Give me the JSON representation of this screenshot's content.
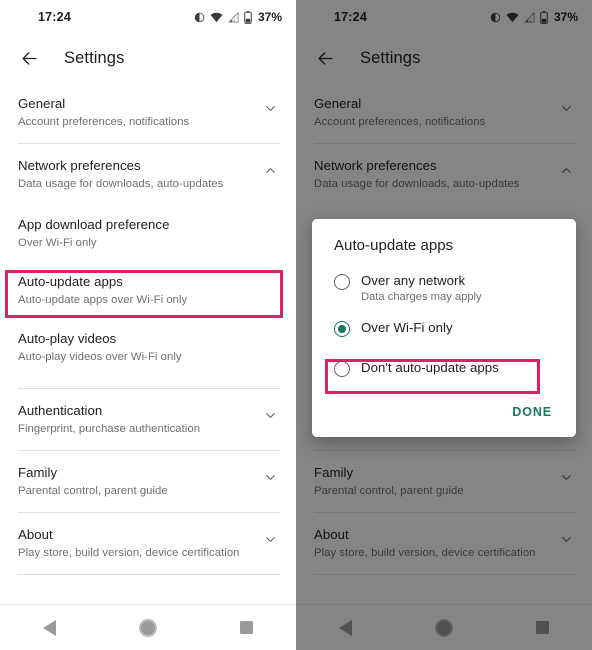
{
  "status_bar": {
    "time": "17:24",
    "battery_percent": "37%",
    "icons": [
      "dnd-icon",
      "wifi-icon",
      "cellular-signal-icon",
      "battery-icon"
    ]
  },
  "app_bar": {
    "back_icon": "arrow-back-icon",
    "title": "Settings"
  },
  "settings_list": [
    {
      "title": "General",
      "subtitle": "Account preferences, notifications",
      "chevron": "chevron-down-icon"
    },
    {
      "title": "Network preferences",
      "subtitle": "Data usage for downloads, auto-updates",
      "chevron": "chevron-up-icon"
    },
    {
      "title": "App download preference",
      "subtitle": "Over Wi-Fi only",
      "chevron": ""
    },
    {
      "title": "Auto-update apps",
      "subtitle": "Auto-update apps over Wi-Fi only",
      "chevron": ""
    },
    {
      "title": "Auto-play videos",
      "subtitle": "Auto-play videos over Wi-Fi only",
      "chevron": ""
    },
    {
      "title": "Authentication",
      "subtitle": "Fingerprint, purchase authentication",
      "chevron": "chevron-down-icon"
    },
    {
      "title": "Family",
      "subtitle": "Parental control, parent guide",
      "chevron": "chevron-down-icon"
    },
    {
      "title": "About",
      "subtitle": "Play store, build version, device certification",
      "chevron": "chevron-down-icon"
    }
  ],
  "dialog": {
    "title": "Auto-update apps",
    "options": [
      {
        "label": "Over any network",
        "sublabel": "Data charges may apply",
        "selected": false
      },
      {
        "label": "Over Wi-Fi only",
        "sublabel": "",
        "selected": true
      },
      {
        "label": "Don't auto-update apps",
        "sublabel": "",
        "selected": false
      }
    ],
    "done_label": "DONE"
  },
  "nav_bar": {
    "back": "nav-back-icon",
    "home": "nav-home-icon",
    "recents": "nav-recents-icon"
  },
  "annotations": {
    "highlight_color": "#e02060",
    "accent_color": "#18775f"
  }
}
